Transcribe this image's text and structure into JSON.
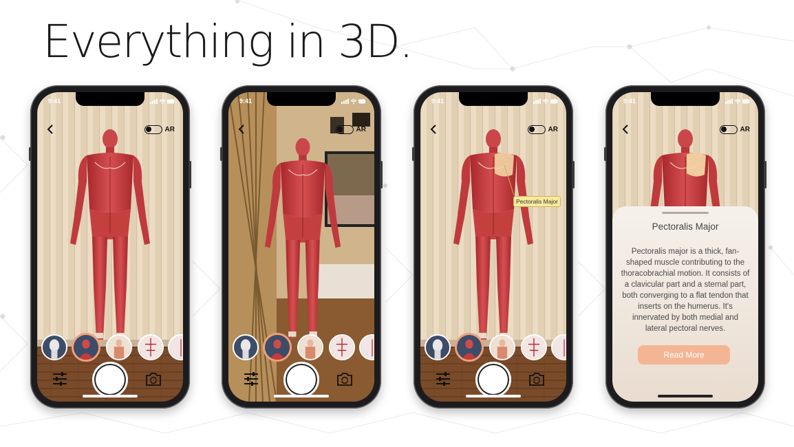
{
  "headline": "Everything in 3D.",
  "status": {
    "time": "9:41"
  },
  "ar_label": "AR",
  "label_tip": "Pectoralis Major",
  "info_sheet": {
    "title": "Pectoralis Major",
    "body": "Pectoralis major is a thick, fan-shaped muscle contributing to the thoracobrachial motion. It consists of a clavicular part and a sternal part, both converging to a flat tendon that inserts on the humerus. It's innervated by both medial and lateral pectoral nerves.",
    "button": "Read More"
  },
  "colors": {
    "accent": "#f0a07a",
    "muscle": "#c53a3c",
    "tip_bg": "#f6eaa0",
    "sheet_bg": "#f3ede6"
  },
  "icons": [
    "back-chevron-icon",
    "toggle-icon",
    "sliders-icon",
    "camera-rotate-icon",
    "signal-icon",
    "wifi-icon",
    "battery-icon"
  ],
  "layer_thumbs": [
    "skeleton",
    "muscles",
    "organs",
    "vessels",
    "partial"
  ]
}
